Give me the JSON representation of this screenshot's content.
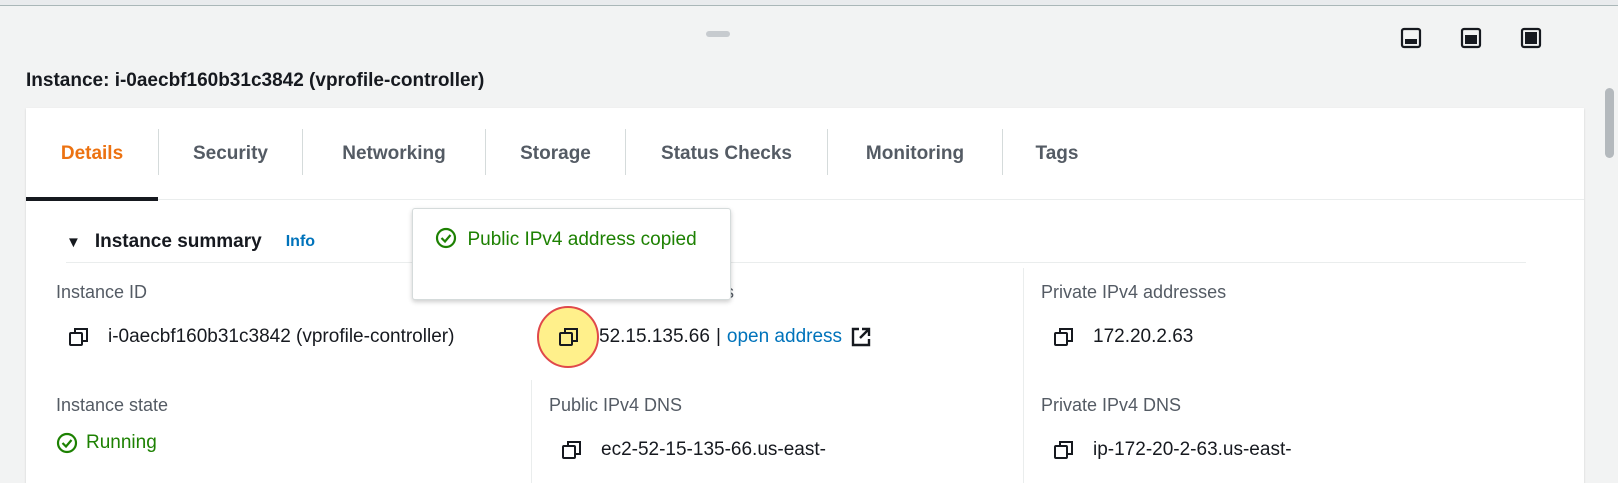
{
  "panel": {
    "title": "Instance: i-0aecbf160b31c3842 (vprofile-controller)"
  },
  "tabs": [
    {
      "label": "Details",
      "active": true
    },
    {
      "label": "Security",
      "active": false
    },
    {
      "label": "Networking",
      "active": false
    },
    {
      "label": "Storage",
      "active": false
    },
    {
      "label": "Status Checks",
      "active": false
    },
    {
      "label": "Monitoring",
      "active": false
    },
    {
      "label": "Tags",
      "active": false
    }
  ],
  "summary": {
    "title": "Instance summary",
    "info_link": "Info"
  },
  "tooltip": {
    "message": "Public IPv4 address copied"
  },
  "fields": {
    "instance_id": {
      "label": "Instance ID",
      "value": "i-0aecbf160b31c3842 (vprofile-controller)"
    },
    "public_ipv4": {
      "label_fragment": "s",
      "value": "52.15.135.66",
      "separator": "|",
      "link_text": "open address"
    },
    "private_ipv4": {
      "label": "Private IPv4 addresses",
      "value": "172.20.2.63"
    },
    "instance_state": {
      "label": "Instance state",
      "value": "Running"
    },
    "public_dns": {
      "label": "Public IPv4 DNS",
      "value": "ec2-52-15-135-66.us-east-"
    },
    "private_dns": {
      "label": "Private IPv4 DNS",
      "value": "ip-172-20-2-63.us-east-"
    }
  },
  "colors": {
    "accent_orange": "#ec7211",
    "link_blue": "#0073bb",
    "success_green": "#1d8102",
    "text_dark": "#16191f",
    "text_label": "#545b64"
  },
  "icons": [
    "minimize-panel-icon",
    "split-panel-icon",
    "maximize-panel-icon",
    "caret-down-icon",
    "copy-icon",
    "external-link-icon",
    "check-circle-icon"
  ]
}
